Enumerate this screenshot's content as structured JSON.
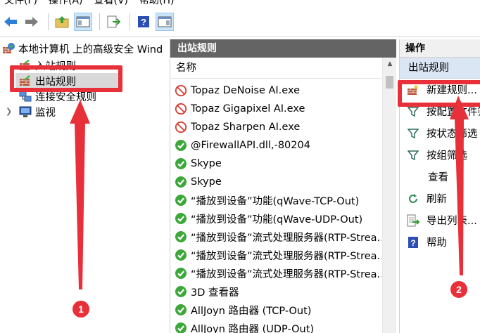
{
  "menu": [
    "文件(F)",
    "操作(A)",
    "查看(V)",
    "帮助(H)"
  ],
  "toolbar": {
    "buttons": [
      "back-arrow-icon",
      "forward-arrow-icon",
      "up-folder-icon",
      "show-hide-tree-icon",
      "export-icon",
      "help-icon",
      "show-hide-action-pane-icon"
    ]
  },
  "tree": {
    "root": "本地计算机 上的高级安全 Wind",
    "items": [
      {
        "label": "入站规则"
      },
      {
        "label": "出站规则"
      },
      {
        "label": "连接安全规则"
      },
      {
        "label": "监视"
      }
    ]
  },
  "middle": {
    "header": "出站规则",
    "column": "名称",
    "rows": [
      {
        "status": "blocked",
        "name": "Topaz DeNoise AI.exe"
      },
      {
        "status": "blocked",
        "name": "Topaz Gigapixel AI.exe"
      },
      {
        "status": "blocked",
        "name": "Topaz Sharpen AI.exe"
      },
      {
        "status": "allowed",
        "name": "@FirewallAPI.dll,-80204"
      },
      {
        "status": "allowed",
        "name": "Skype"
      },
      {
        "status": "allowed",
        "name": "Skype"
      },
      {
        "status": "allowed",
        "name": "“播放到设备”功能(qWave-TCP-Out)"
      },
      {
        "status": "allowed",
        "name": "“播放到设备”功能(qWave-UDP-Out)"
      },
      {
        "status": "allowed",
        "name": "“播放到设备”流式处理服务器(RTP-Strea..."
      },
      {
        "status": "allowed",
        "name": "“播放到设备”流式处理服务器(RTP-Strea..."
      },
      {
        "status": "allowed",
        "name": "“播放到设备”流式处理服务器(RTP-Strea..."
      },
      {
        "status": "allowed",
        "name": "3D 查看器"
      },
      {
        "status": "allowed",
        "name": "AllJoyn 路由器 (TCP-Out)"
      },
      {
        "status": "allowed",
        "name": "AllJoyn 路由器 (UDP-Out)"
      }
    ]
  },
  "actions": {
    "title": "操作",
    "section": "出站规则",
    "items": [
      {
        "icon": "new-rule-icon",
        "label": "新建规则..."
      },
      {
        "icon": "filter-icon",
        "label": "按配置文件筛选"
      },
      {
        "icon": "filter-icon",
        "label": "按状态筛选"
      },
      {
        "icon": "filter-icon",
        "label": "按组筛选"
      },
      {
        "icon": "",
        "label": "查看"
      },
      {
        "icon": "refresh-icon",
        "label": "刷新"
      },
      {
        "icon": "export-list-icon",
        "label": "导出列表..."
      },
      {
        "icon": "help-icon",
        "label": "帮助"
      }
    ]
  },
  "annotations": {
    "badge1": "1",
    "badge2": "2",
    "color": "#e8303a"
  }
}
